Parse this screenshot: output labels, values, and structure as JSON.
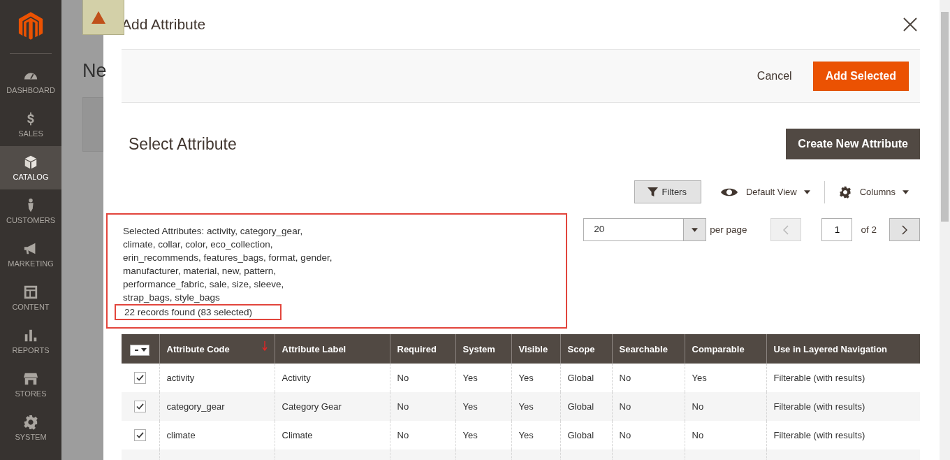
{
  "sidebar": {
    "items": [
      {
        "label": "DASHBOARD",
        "selected": false
      },
      {
        "label": "SALES",
        "selected": false
      },
      {
        "label": "CATALOG",
        "selected": true
      },
      {
        "label": "CUSTOMERS",
        "selected": false
      },
      {
        "label": "MARKETING",
        "selected": false
      },
      {
        "label": "CONTENT",
        "selected": false
      },
      {
        "label": "REPORTS",
        "selected": false
      },
      {
        "label": "STORES",
        "selected": false
      },
      {
        "label": "SYSTEM",
        "selected": false
      }
    ]
  },
  "backdrop": {
    "page_title": "Ne"
  },
  "modal": {
    "title": "Add Attribute",
    "actions": {
      "cancel": "Cancel",
      "primary": "Add Selected"
    },
    "section_title": "Select Attribute",
    "create_button": "Create New Attribute",
    "toolbar": {
      "filters": "Filters",
      "view": "Default View",
      "columns": "Columns"
    },
    "summary": {
      "highlighted": true,
      "selected_text": "Selected Attributes: activity, category_gear, climate, collar, color, eco_collection, erin_recommends, features_bags, format, gender, manufacturer, material, new, pattern, performance_fabric, sale, size, sleeve, strap_bags, style_bags",
      "count": "22 records found (83 selected)",
      "count_highlighted": true
    },
    "pager": {
      "per_page_value": "20",
      "per_page_label": "per page",
      "page": "1",
      "of": "of 2",
      "prev_disabled": true,
      "next_disabled": false
    },
    "table": {
      "header_checkbox_partial": true,
      "columns": [
        {
          "label": "Attribute Code",
          "sorted": true
        },
        {
          "label": "Attribute Label",
          "sorted": false
        },
        {
          "label": "Required",
          "sorted": false
        },
        {
          "label": "System",
          "sorted": false
        },
        {
          "label": "Visible",
          "sorted": false
        },
        {
          "label": "Scope",
          "sorted": false
        },
        {
          "label": "Searchable",
          "sorted": false
        },
        {
          "label": "Comparable",
          "sorted": false
        },
        {
          "label": "Use in Layered Navigation",
          "sorted": false
        }
      ],
      "rows": [
        {
          "checked": true,
          "cells": [
            "activity",
            "Activity",
            "No",
            "Yes",
            "Yes",
            "Global",
            "No",
            "Yes",
            "Filterable (with results)"
          ]
        },
        {
          "checked": true,
          "cells": [
            "category_gear",
            "Category Gear",
            "No",
            "Yes",
            "Yes",
            "Global",
            "No",
            "No",
            "Filterable (with results)"
          ]
        },
        {
          "checked": true,
          "cells": [
            "climate",
            "Climate",
            "No",
            "Yes",
            "Yes",
            "Global",
            "No",
            "No",
            "Filterable (with results)"
          ]
        }
      ]
    }
  }
}
